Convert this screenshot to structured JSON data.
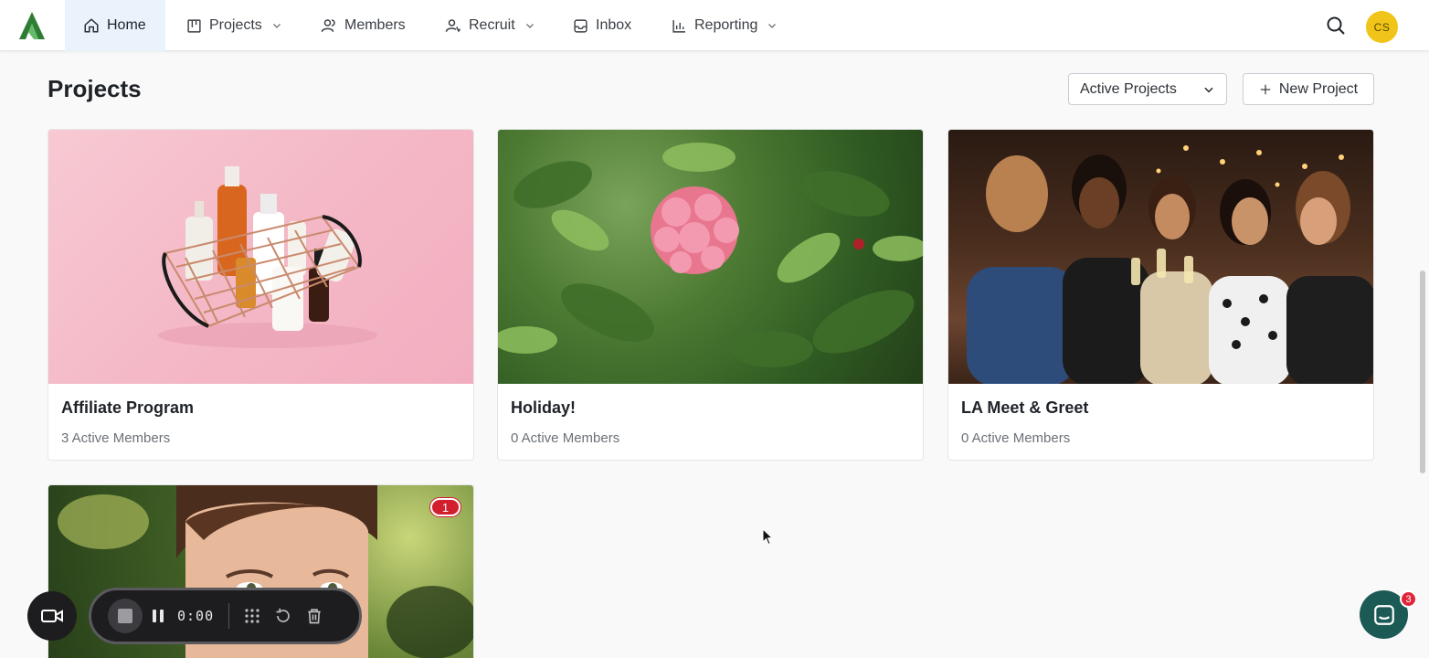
{
  "nav": {
    "items": [
      {
        "label": "Home",
        "icon": "home-icon",
        "active": true,
        "dropdown": false
      },
      {
        "label": "Projects",
        "icon": "board-icon",
        "active": false,
        "dropdown": true
      },
      {
        "label": "Members",
        "icon": "members-icon",
        "active": false,
        "dropdown": false
      },
      {
        "label": "Recruit",
        "icon": "recruit-icon",
        "active": false,
        "dropdown": true
      },
      {
        "label": "Inbox",
        "icon": "inbox-icon",
        "active": false,
        "dropdown": false
      },
      {
        "label": "Reporting",
        "icon": "chart-icon",
        "active": false,
        "dropdown": true
      }
    ],
    "avatar_initials": "CS"
  },
  "page": {
    "title": "Projects",
    "filter": {
      "selected": "Active Projects"
    },
    "new_project_label": "New Project"
  },
  "projects": [
    {
      "title": "Affiliate Program",
      "members": "3 Active Members"
    },
    {
      "title": "Holiday!",
      "members": "0 Active Members"
    },
    {
      "title": "LA Meet & Greet",
      "members": "0 Active Members"
    },
    {
      "badge": "1"
    }
  ],
  "recorder": {
    "time": "0:00"
  },
  "chat": {
    "unread": "3"
  },
  "colors": {
    "brand_green": "#2e7d32",
    "active_nav_bg": "#eaf2fb",
    "avatar_bg": "#f0c419",
    "badge_red": "#d21f2e",
    "chat_bg": "#1c5a55"
  }
}
